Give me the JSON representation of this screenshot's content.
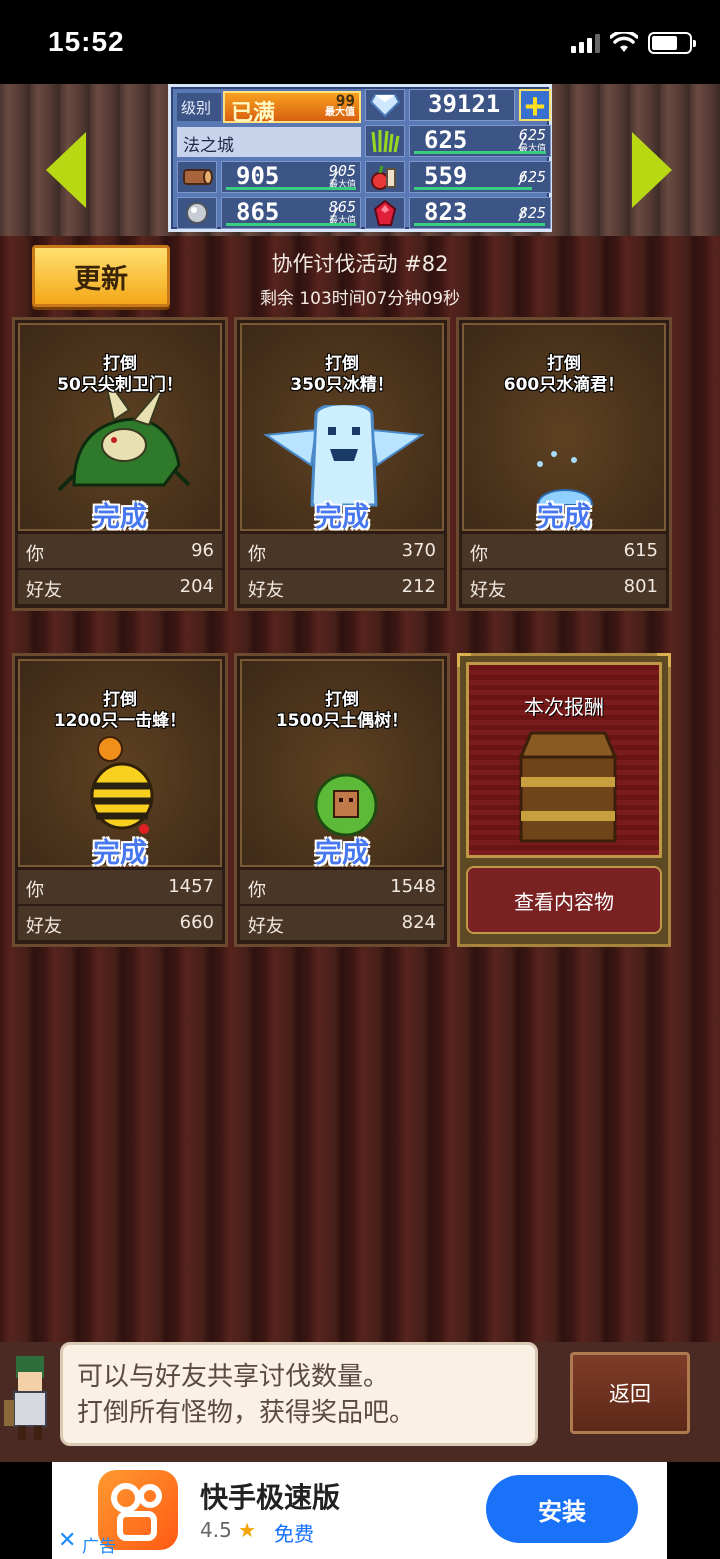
{
  "status_bar": {
    "time": "15:52"
  },
  "header": {
    "level_label": "级别",
    "level_value": "已满",
    "level_max_number": "99",
    "level_max_caption": "最大值",
    "gems": "39121",
    "city_name": "法之城",
    "wood": {
      "current": "905",
      "max": "905",
      "caption": "最大值",
      "fill": 1.0
    },
    "grass": {
      "current": "625",
      "max": "625",
      "caption": "最大值",
      "fill": 1.0
    },
    "food": {
      "current": "559",
      "max": "625",
      "fill": 0.89
    },
    "ore": {
      "current": "865",
      "max": "865",
      "caption": "最大值",
      "fill": 1.0
    },
    "ruby": {
      "current": "823",
      "max": "825",
      "fill": 0.99
    },
    "slash": "/"
  },
  "event": {
    "update_button": "更新",
    "title": "协作讨伐活动 #82",
    "remaining": "剩余 103时间07分钟09秒"
  },
  "labels": {
    "you": "你",
    "friends": "好友",
    "complete": "完成"
  },
  "quests": [
    {
      "goal_line1": "打倒",
      "goal_line2": "50只尖刺卫门！",
      "you": "96",
      "friends": "204"
    },
    {
      "goal_line1": "打倒",
      "goal_line2": "350只冰精！",
      "you": "370",
      "friends": "212"
    },
    {
      "goal_line1": "打倒",
      "goal_line2": "600只水滴君！",
      "you": "615",
      "friends": "801"
    },
    {
      "goal_line1": "打倒",
      "goal_line2": "1200只一击蜂！",
      "you": "1457",
      "friends": "660"
    },
    {
      "goal_line1": "打倒",
      "goal_line2": "1500只土偶树！",
      "you": "1548",
      "friends": "824"
    }
  ],
  "reward": {
    "title": "本次报酬",
    "view_button": "查看内容物"
  },
  "message": {
    "line1": "可以与好友共享讨伐数量。",
    "line2": "打倒所有怪物，获得奖品吧。"
  },
  "back_button": "返回",
  "ad": {
    "app_name": "快手极速版",
    "rating": "4.5",
    "price": "免费",
    "install_button": "安装",
    "ad_label": "广告"
  }
}
